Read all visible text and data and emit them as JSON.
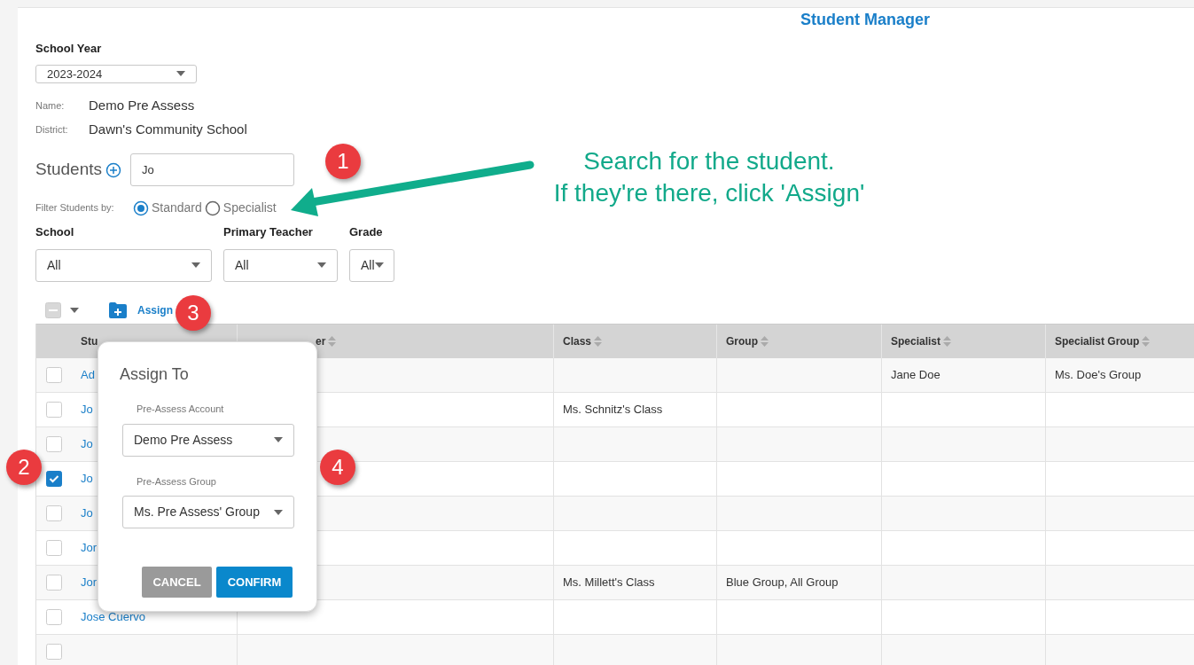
{
  "page_title": "Student Manager",
  "school_year": {
    "label": "School Year",
    "value": "2023-2024"
  },
  "info": [
    {
      "label": "Name:",
      "value": "Demo Pre Assess"
    },
    {
      "label": "District:",
      "value": "Dawn's Community School"
    }
  ],
  "students": {
    "heading": "Students",
    "search_value": "Jo"
  },
  "filter": {
    "label": "Filter Students by:",
    "options": [
      {
        "label": "Standard",
        "selected": true
      },
      {
        "label": "Specialist",
        "selected": false
      }
    ]
  },
  "filters": [
    {
      "label": "School",
      "value": "All"
    },
    {
      "label": "Primary Teacher",
      "value": "All"
    },
    {
      "label": "Grade",
      "value": "All"
    }
  ],
  "toolbar": {
    "bulk_indeterminate": true,
    "assign_label": "Assign"
  },
  "table": {
    "columns": [
      "Stu",
      "er",
      "Class",
      "Group",
      "Specialist",
      "Specialist Group"
    ],
    "rows": [
      {
        "checked": false,
        "cells": [
          "Ad",
          "",
          "",
          "",
          "Jane Doe",
          "Ms. Doe's Group"
        ]
      },
      {
        "checked": false,
        "cells": [
          "Jo",
          "",
          "Ms. Schnitz's Class",
          "",
          "",
          ""
        ]
      },
      {
        "checked": false,
        "cells": [
          "Jo",
          "",
          "",
          "",
          "",
          ""
        ]
      },
      {
        "checked": true,
        "cells": [
          "Jo",
          "",
          "",
          "",
          "",
          ""
        ]
      },
      {
        "checked": false,
        "cells": [
          "Jo",
          "",
          "",
          "",
          "",
          ""
        ]
      },
      {
        "checked": false,
        "cells": [
          "Jor",
          "",
          "",
          "",
          "",
          ""
        ]
      },
      {
        "checked": false,
        "cells": [
          "Jor",
          "",
          "Ms. Millett's Class",
          "Blue Group, All Group",
          "",
          ""
        ]
      },
      {
        "checked": false,
        "cells": [
          "Jose Cuervo",
          "",
          "",
          "",
          "",
          ""
        ]
      },
      {
        "checked": false,
        "cells": [
          "",
          "",
          "",
          "",
          "",
          ""
        ]
      }
    ]
  },
  "assign_dialog": {
    "title": "Assign To",
    "fields": [
      {
        "label": "Pre-Assess Account",
        "value": "Demo Pre Assess"
      },
      {
        "label": "Pre-Assess Group",
        "value": "Ms. Pre Assess' Group"
      }
    ],
    "buttons": [
      {
        "label": "CANCEL",
        "kind": "secondary"
      },
      {
        "label": "CONFIRM",
        "kind": "primary"
      }
    ]
  },
  "annotation": {
    "lines": [
      "Search for the student.",
      "If they're there, click 'Assign'"
    ],
    "steps": [
      "1",
      "2",
      "3",
      "4"
    ]
  }
}
